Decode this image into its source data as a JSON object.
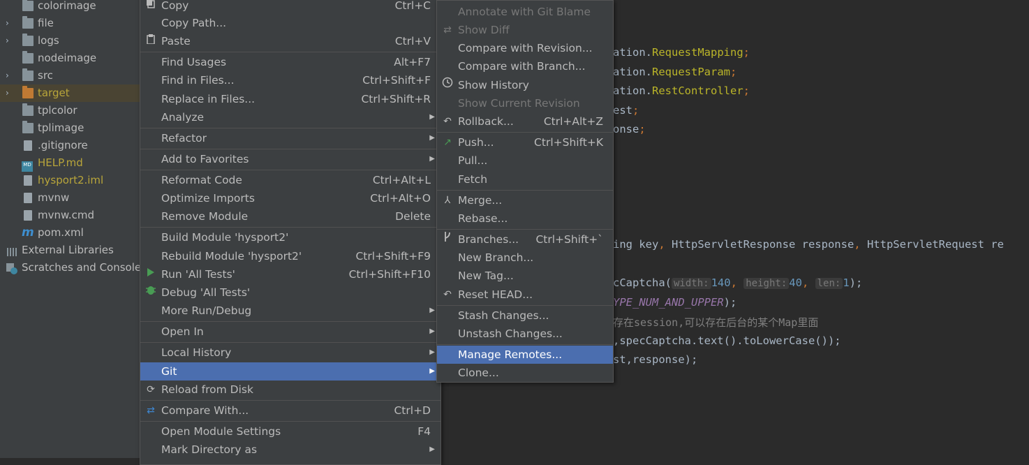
{
  "project_tree": {
    "items": [
      {
        "label": "colorimage",
        "kind": "folder",
        "chevron": ""
      },
      {
        "label": "file",
        "kind": "folder",
        "chevron": "›"
      },
      {
        "label": "logs",
        "kind": "folder",
        "chevron": "›"
      },
      {
        "label": "nodeimage",
        "kind": "folder",
        "chevron": ""
      },
      {
        "label": "src",
        "kind": "folder",
        "chevron": "›"
      },
      {
        "label": "target",
        "kind": "folder-orange",
        "chevron": "›"
      },
      {
        "label": "tplcolor",
        "kind": "folder",
        "chevron": ""
      },
      {
        "label": "tplimage",
        "kind": "folder",
        "chevron": ""
      },
      {
        "label": ".gitignore",
        "kind": "file",
        "chevron": ""
      },
      {
        "label": "HELP.md",
        "kind": "md",
        "chevron": ""
      },
      {
        "label": "hysport2.iml",
        "kind": "file",
        "chevron": ""
      },
      {
        "label": "mvnw",
        "kind": "file",
        "chevron": ""
      },
      {
        "label": "mvnw.cmd",
        "kind": "file",
        "chevron": ""
      },
      {
        "label": "pom.xml",
        "kind": "maven",
        "chevron": ""
      },
      {
        "label": "External Libraries",
        "kind": "libs",
        "chevron": ""
      },
      {
        "label": "Scratches and Consoles",
        "kind": "scratch",
        "chevron": ""
      }
    ],
    "md_badge": "MD",
    "maven_glyph": "m"
  },
  "editor": {
    "lines": [
      {
        "a": "ation.",
        "b": "RequestMapping",
        ";": ";"
      },
      {
        "a": "ation.",
        "b": "RequestParam",
        ";": ";"
      },
      {
        "a": "ation.",
        "b": "RestController",
        ";": ";"
      },
      {
        "a": "est",
        ";": ";"
      },
      {
        "a": "onse",
        ";": ";"
      }
    ],
    "sig": {
      "p1": "ing key",
      ",": ",",
      "p2": " HttpServletResponse response",
      ",2": ",",
      "p3": " HttpServletRequest re"
    },
    "captcha": {
      "pre": "cCaptcha(",
      "h1": "width:",
      "v1": "140",
      "h2": "height:",
      "v2": "40",
      "h3": "len:",
      "v3": "1",
      "post": ");"
    },
    "type_const": "YPE_NUM_AND_UPPER",
    "type_post": ");",
    "comment": "存在session,可以存在后台的某个Map里面",
    "line_text": ",specCaptcha.text().toLowerCase());",
    "line_resp": "st,response);"
  },
  "menu1": {
    "items": [
      {
        "label": "Copy",
        "shortcut": "Ctrl+C",
        "icon": "copy-icon"
      },
      {
        "label": "Copy Path...",
        "shortcut": ""
      },
      {
        "label": "Paste",
        "shortcut": "Ctrl+V",
        "icon": "paste-icon"
      },
      {
        "label": "Find Usages",
        "shortcut": "Alt+F7"
      },
      {
        "label": "Find in Files...",
        "shortcut": "Ctrl+Shift+F"
      },
      {
        "label": "Replace in Files...",
        "shortcut": "Ctrl+Shift+R"
      },
      {
        "label": "Analyze",
        "shortcut": "",
        "submenu": true
      },
      {
        "label": "Refactor",
        "shortcut": "",
        "submenu": true
      },
      {
        "label": "Add to Favorites",
        "shortcut": "",
        "submenu": true
      },
      {
        "label": "Reformat Code",
        "shortcut": "Ctrl+Alt+L"
      },
      {
        "label": "Optimize Imports",
        "shortcut": "Ctrl+Alt+O"
      },
      {
        "label": "Remove Module",
        "shortcut": "Delete"
      },
      {
        "label": "Build Module 'hysport2'",
        "shortcut": ""
      },
      {
        "label": "Rebuild Module 'hysport2'",
        "shortcut": "Ctrl+Shift+F9"
      },
      {
        "label": "Run 'All Tests'",
        "shortcut": "Ctrl+Shift+F10",
        "icon": "run-icon"
      },
      {
        "label": "Debug 'All Tests'",
        "shortcut": "",
        "icon": "debug-icon"
      },
      {
        "label": "More Run/Debug",
        "shortcut": "",
        "submenu": true
      },
      {
        "label": "Open In",
        "shortcut": "",
        "submenu": true
      },
      {
        "label": "Local History",
        "shortcut": "",
        "submenu": true
      },
      {
        "label": "Git",
        "shortcut": "",
        "submenu": true,
        "highlighted": true
      },
      {
        "label": "Reload from Disk",
        "shortcut": "",
        "icon": "reload-icon"
      },
      {
        "label": "Compare With...",
        "shortcut": "Ctrl+D",
        "icon": "compare-icon"
      },
      {
        "label": "Open Module Settings",
        "shortcut": "F4"
      },
      {
        "label": "Mark Directory as",
        "shortcut": "",
        "submenu": true
      }
    ]
  },
  "menu2": {
    "items": [
      {
        "label": "Annotate with Git Blame",
        "shortcut": "",
        "disabled": true
      },
      {
        "label": "Show Diff",
        "shortcut": "",
        "disabled": true,
        "icon": "diff-icon"
      },
      {
        "label": "Compare with Revision...",
        "shortcut": ""
      },
      {
        "label": "Compare with Branch...",
        "shortcut": ""
      },
      {
        "label": "Show History",
        "shortcut": "",
        "icon": "history-icon"
      },
      {
        "label": "Show Current Revision",
        "shortcut": "",
        "disabled": true
      },
      {
        "label": "Rollback...",
        "shortcut": "Ctrl+Alt+Z",
        "icon": "rollback-icon"
      },
      {
        "label": "Push...",
        "shortcut": "Ctrl+Shift+K",
        "icon": "push-icon"
      },
      {
        "label": "Pull...",
        "shortcut": ""
      },
      {
        "label": "Fetch",
        "shortcut": ""
      },
      {
        "label": "Merge...",
        "shortcut": "",
        "icon": "merge-icon"
      },
      {
        "label": "Rebase...",
        "shortcut": ""
      },
      {
        "label": "Branches...",
        "shortcut": "Ctrl+Shift+`",
        "icon": "branch-icon"
      },
      {
        "label": "New Branch...",
        "shortcut": ""
      },
      {
        "label": "New Tag...",
        "shortcut": ""
      },
      {
        "label": "Reset HEAD...",
        "shortcut": "",
        "icon": "reset-icon"
      },
      {
        "label": "Stash Changes...",
        "shortcut": ""
      },
      {
        "label": "Unstash Changes...",
        "shortcut": ""
      },
      {
        "label": "Manage Remotes...",
        "shortcut": "",
        "highlighted": true
      },
      {
        "label": "Clone...",
        "shortcut": ""
      }
    ]
  },
  "colors": {
    "highlight": "#4b6eaf",
    "menu_bg": "#3c3f41",
    "tree_bg": "#3c3f41",
    "editor_bg": "#2b2b2b",
    "target_sel": "#4a4433"
  }
}
